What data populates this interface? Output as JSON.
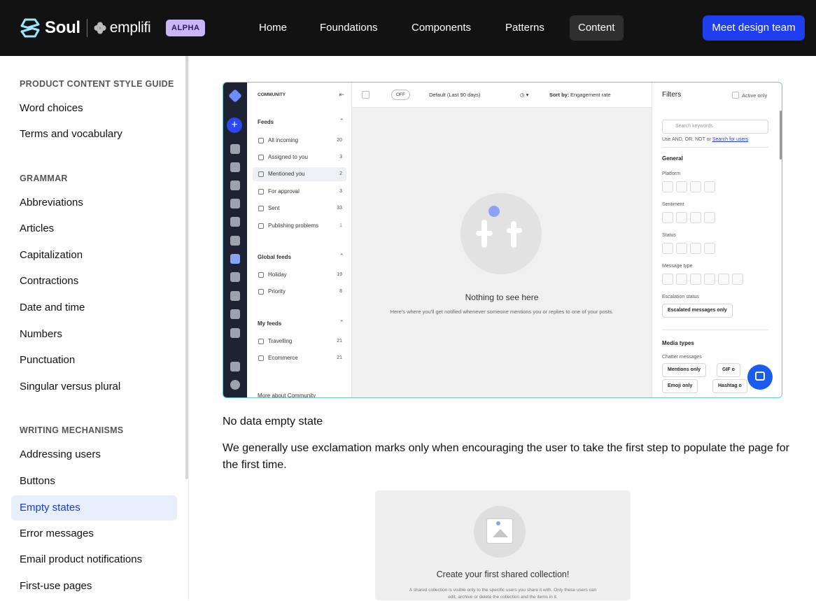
{
  "header": {
    "brand": "Soul",
    "partner": "emplifi",
    "badge": "ALPHA",
    "nav": [
      "Home",
      "Foundations",
      "Components",
      "Patterns",
      "Content"
    ],
    "active_nav": "Content",
    "cta": "Meet design team"
  },
  "sidebar": {
    "sections": [
      {
        "title": "PRODUCT CONTENT STYLE GUIDE",
        "items": [
          "Word choices",
          "Terms and vocabulary"
        ]
      },
      {
        "title": "GRAMMAR",
        "items": [
          "Abbreviations",
          "Articles",
          "Capitalization",
          "Contractions",
          "Date and time",
          "Numbers",
          "Punctuation",
          "Singular versus plural"
        ]
      },
      {
        "title": "WRITING MECHANISMS",
        "items": [
          "Addressing users",
          "Buttons",
          "Empty states",
          "Error messages",
          "Email product notifications",
          "First-use pages"
        ]
      }
    ],
    "active_item": "Empty states"
  },
  "screenshot1": {
    "section_label": "COMMUNITY",
    "feeds_title": "Feeds",
    "feeds": [
      {
        "label": "All incoming",
        "count": "20"
      },
      {
        "label": "Assigned to you",
        "count": "3"
      },
      {
        "label": "Mentioned you",
        "count": "2"
      },
      {
        "label": "For approval",
        "count": "3"
      },
      {
        "label": "Sent",
        "count": "33"
      },
      {
        "label": "Publishing problems",
        "count": "1"
      }
    ],
    "global_title": "Global feeds",
    "global": [
      {
        "label": "Holiday",
        "count": "19"
      },
      {
        "label": "Priority",
        "count": "8"
      }
    ],
    "my_title": "My feeds",
    "my": [
      {
        "label": "Travelling",
        "count": "21"
      },
      {
        "label": "Ecommerce",
        "count": "21"
      }
    ],
    "more": "More about Community",
    "toolbar": {
      "toggle": "OFF",
      "range": "Default (Last 90 days)",
      "sort_prefix": "Sort by:",
      "sort_value": "Engagement rate"
    },
    "empty_title": "Nothing to see here",
    "empty_sub": "Here's where you'll get notified whenever someone mentions you or replies to one of your posts.",
    "filters": {
      "title": "Filters",
      "active_only": "Active only",
      "search_placeholder": "Search keywords",
      "hint": "Use AND, OR, NOT or",
      "hint_link": "Search for users",
      "general": "General",
      "platform": "Platform",
      "sentiment": "Sentiment",
      "status": "Status",
      "message_type": "Message type",
      "escalation": "Escalation status",
      "escalated_btn": "Escalated messages only",
      "media_types": "Media types",
      "chatter": "Chatter messages",
      "mentions_btn": "Mentions only",
      "gif_btn": "GIF o",
      "emoji_btn": "Emoji only",
      "hashtag_btn": "Hashtag o"
    }
  },
  "caption": "No data empty state",
  "paragraph": "We generally use exclamation marks only when encouraging the user to take the first step to populate the page for the first time.",
  "screenshot2": {
    "title": "Create your first shared collection!",
    "sub": "A shared collection is visible only to the specific users you share it with. Only these users can edit, archive or delete the collection and the items in it."
  }
}
